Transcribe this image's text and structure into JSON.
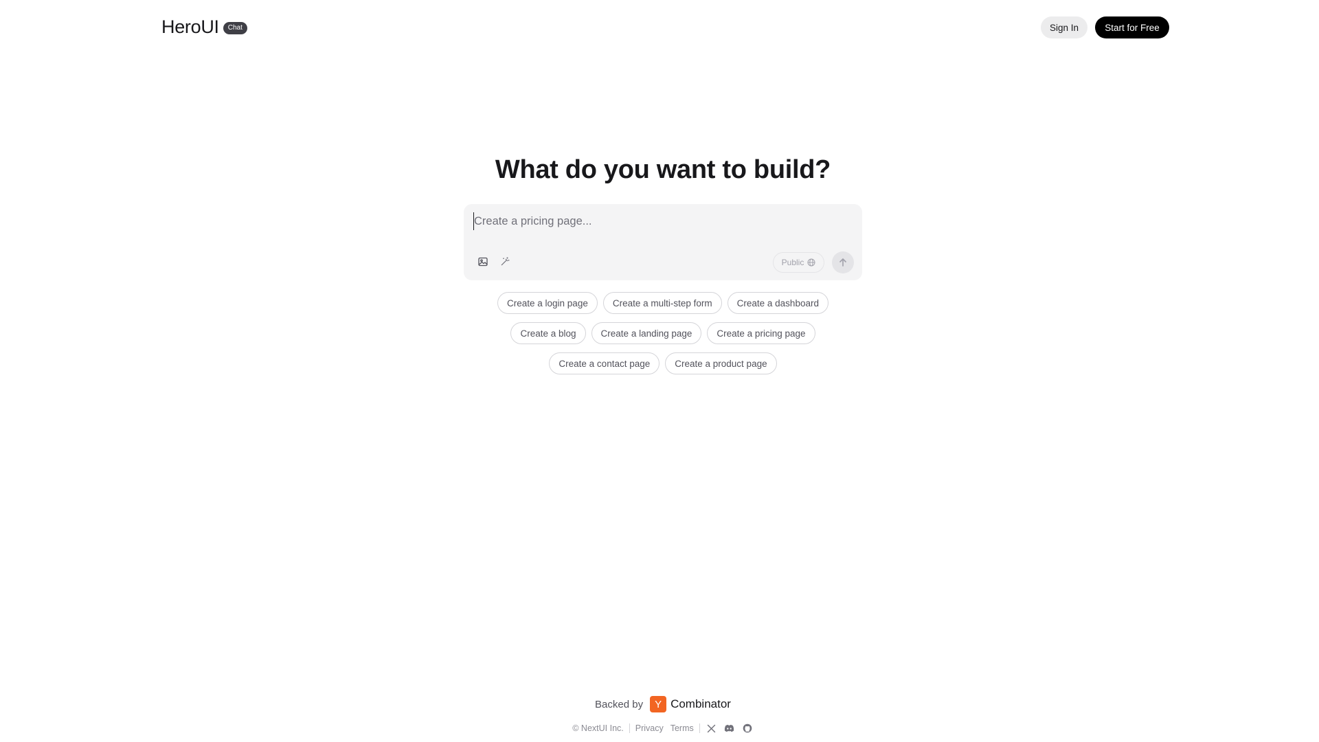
{
  "header": {
    "logo_text": "HeroUI",
    "logo_badge": "Chat",
    "sign_in_label": "Sign In",
    "start_label": "Start for Free"
  },
  "hero": {
    "title": "What do you want to build?"
  },
  "prompt": {
    "value": "",
    "placeholder": "Create a pricing page...",
    "tools": [
      {
        "icon": "image-icon"
      },
      {
        "icon": "magic-wand-icon"
      }
    ],
    "visibility_label": "Public",
    "visibility_icon": "globe-icon",
    "send_icon": "arrow-up-icon"
  },
  "suggestions": [
    "Create a login page",
    "Create a multi-step form",
    "Create a dashboard",
    "Create a blog",
    "Create a landing page",
    "Create a pricing page",
    "Create a contact page",
    "Create a product page"
  ],
  "footer": {
    "backed_label": "Backed by",
    "yc_logo_letter": "Y",
    "yc_name": "Combinator",
    "copyright": "© NextUI Inc.",
    "privacy": "Privacy",
    "terms": "Terms",
    "social_icons": [
      "x-icon",
      "discord-icon",
      "github-icon"
    ]
  },
  "colors": {
    "primary_button": "#000000",
    "secondary_button": "#ececed",
    "prompt_background": "#f4f4f5",
    "yc_orange": "#f26522"
  }
}
